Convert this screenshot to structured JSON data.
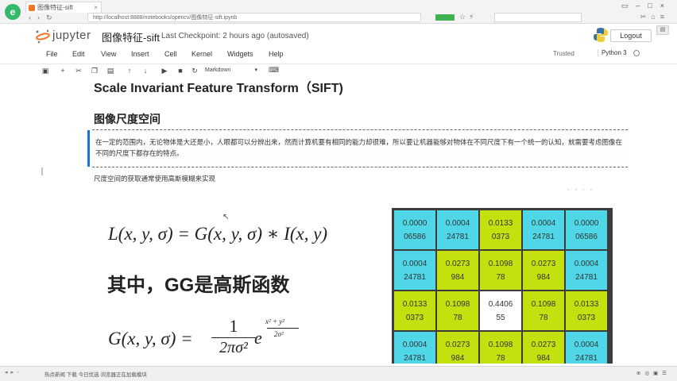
{
  "browser": {
    "tab_title": "图像特征-sift",
    "address": "http://localhost:8888/notebooks/opencv/图像特征-sift.ipynb"
  },
  "header": {
    "brand": "jupyter",
    "notebook_title": "图像特征-sift",
    "checkpoint": "Last Checkpoint: 2 hours ago (autosaved)",
    "logout": "Logout"
  },
  "menu": {
    "items": [
      "File",
      "Edit",
      "View",
      "Insert",
      "Cell",
      "Kernel",
      "Widgets",
      "Help"
    ],
    "trusted": "Trusted",
    "kernel": "Python 3"
  },
  "toolbar": {
    "cell_type": "Markdown"
  },
  "notebook": {
    "title": "Scale Invariant Feature Transform（SIFT)",
    "section_heading": "图像尺度空间",
    "quote": "在一定的范围内，无论物体是大还是小，人眼都可以分辨出来，然而计算机要有相同的能力却很难，所以要让机器能够对物体在不同尺度下有一个统一的认知，就需要考虑图像在不同的尺度下都存在的特点。",
    "paragraph": "尺度空间的获取通常使用高斯模糊来实现",
    "eq_l": "L(x, y, σ) = G(x, y, σ) ∗ I(x, y)",
    "gg_text": "其中，GG是高斯函数",
    "eq_g_left": "G(x, y, σ) =",
    "eq_g_num": "1",
    "eq_g_den": "2πσ²",
    "eq_g_e": "e",
    "eq_g_exp_num": "x² + y²",
    "eq_g_exp_den": "2σ²"
  },
  "kernel_table": {
    "rows": [
      [
        "0.0000\n06586",
        "0.0004\n24781",
        "0.0133\n0373",
        "0.0004\n24781",
        "0.0000\n06586"
      ],
      [
        "0.0004\n24781",
        "0.0273\n984",
        "0.1098\n78",
        "0.0273\n984",
        "0.0004\n24781"
      ],
      [
        "0.0133\n0373",
        "0.1098\n78",
        "0.4406\n55",
        "0.1098\n78",
        "0.0133\n0373"
      ],
      [
        "0.0004\n24781",
        "0.0273\n984",
        "0.1098\n78",
        "0.0273\n984",
        "0.0004\n24781"
      ]
    ],
    "colors": {
      "cyan": "#4fd7e8",
      "lime": "#c5e00f",
      "center": "#ffffff"
    }
  },
  "status": {
    "text": "热点新闻  下载  今日优选  浏览器正在加载模块"
  }
}
